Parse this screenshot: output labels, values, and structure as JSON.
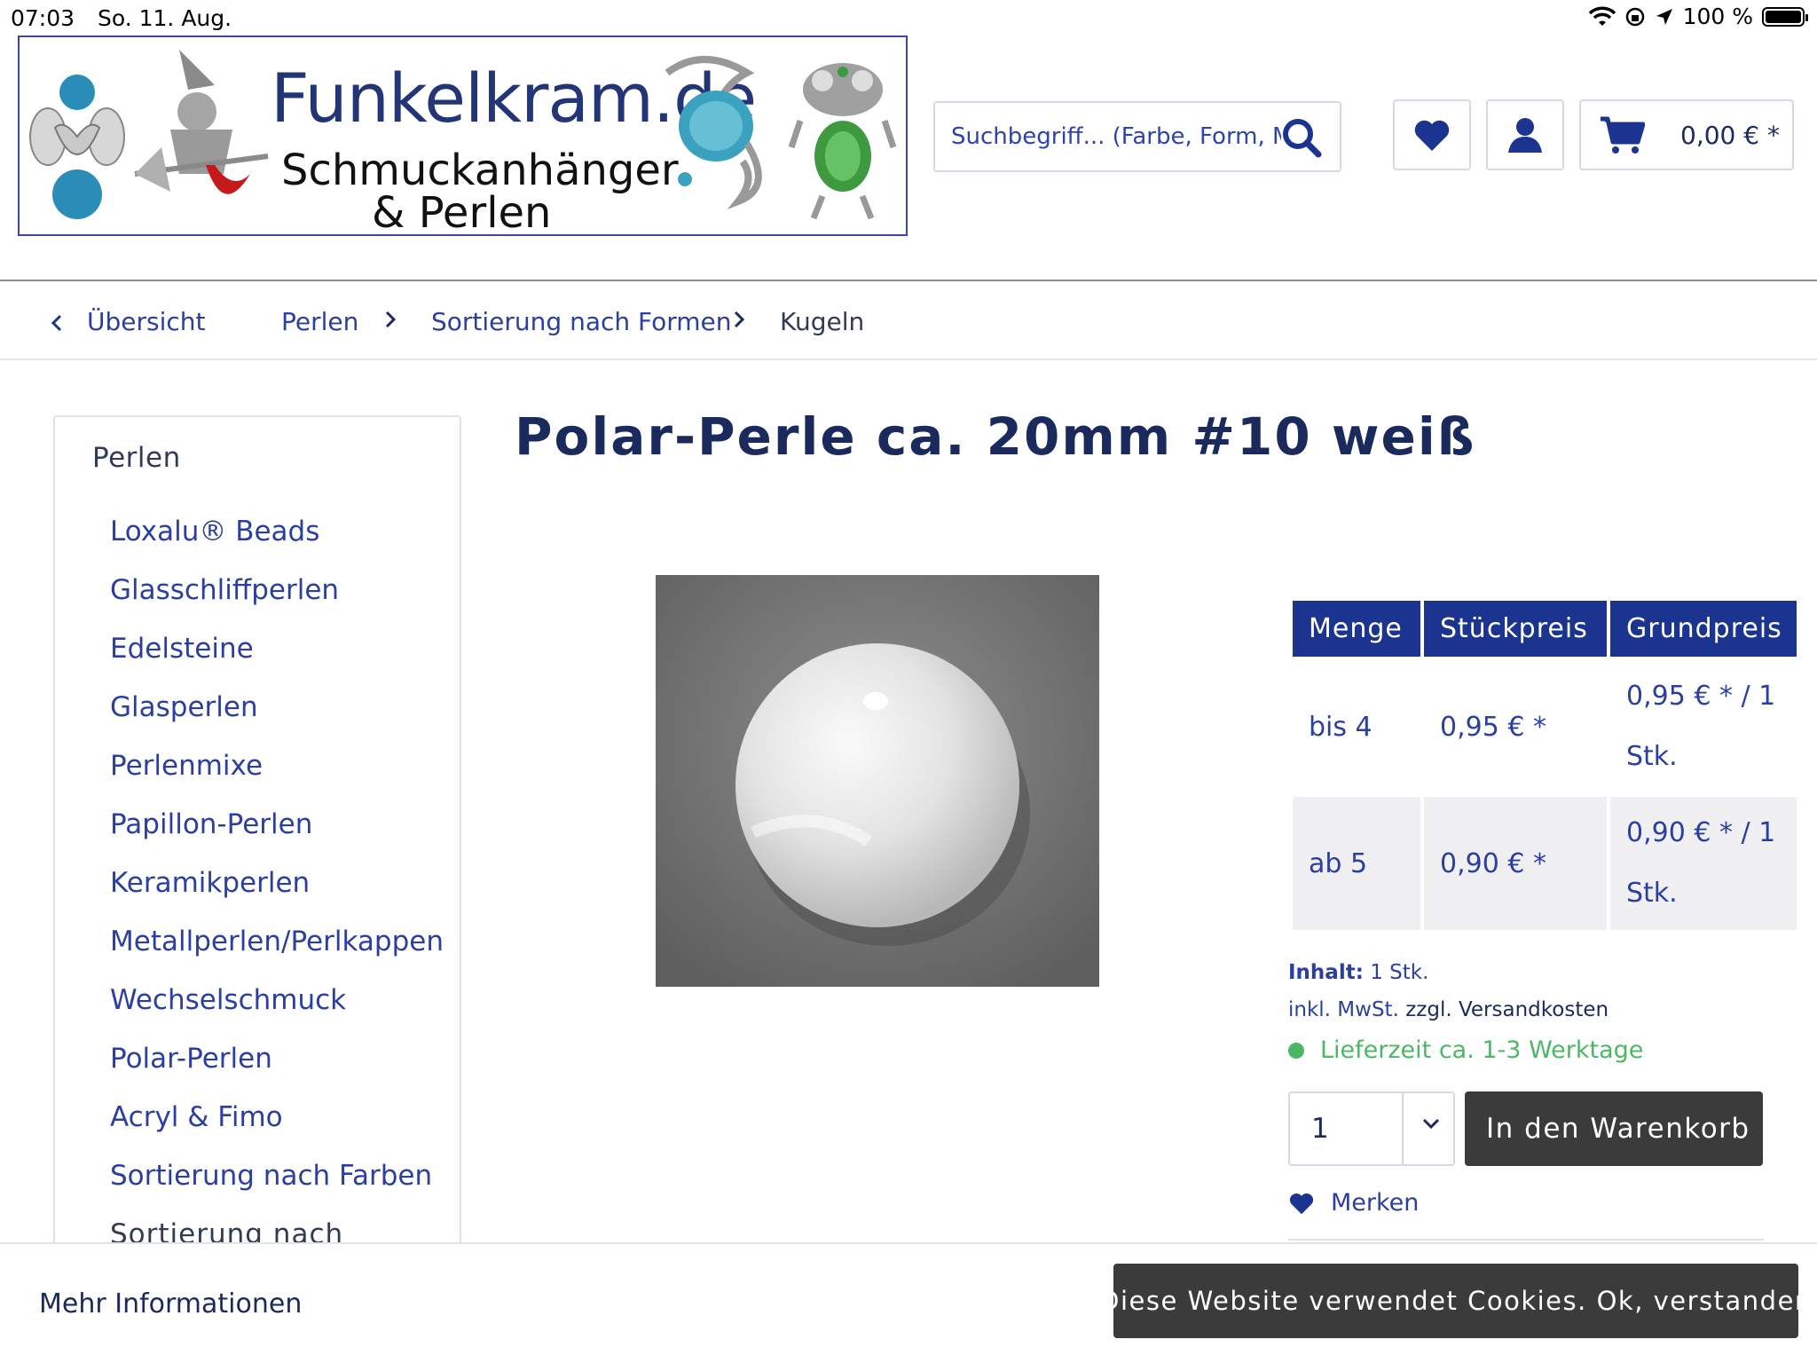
{
  "status_bar": {
    "time": "07:03",
    "date": "So. 11. Aug.",
    "battery": "100 %"
  },
  "header": {
    "logo_title": "Funkelkram.de",
    "logo_subtitle_1": "Schmuckanhänger",
    "logo_subtitle_2": "& Perlen",
    "search_placeholder": "Suchbegriff... (Farbe, Form, Material)",
    "cart_amount": "0,00 € *"
  },
  "breadcrumb": {
    "back": "Übersicht",
    "items": [
      "Perlen",
      "Sortierung nach Formen",
      "Kugeln"
    ]
  },
  "sidebar": {
    "heading": "Perlen",
    "items": [
      "Loxalu® Beads",
      "Glasschliffperlen",
      "Edelsteine",
      "Glasperlen",
      "Perlenmixe",
      "Papillon-Perlen",
      "Keramikperlen",
      "Metallperlen/Perlkappen",
      "Wechselschmuck",
      "Polar-Perlen",
      "Acryl & Fimo",
      "Sortierung nach Farben",
      "Sortierung nach"
    ]
  },
  "product": {
    "title": "Polar-Perle ca. 20mm #10 weiß",
    "price_table": {
      "headers": [
        "Menge",
        "Stückpreis",
        "Grundpreis"
      ],
      "rows": [
        {
          "menge": "bis 4",
          "stueckpreis": "0,95 € *",
          "grundpreis_1": "0,95 € * / 1",
          "grundpreis_2": "Stk."
        },
        {
          "menge": "ab 5",
          "stueckpreis": "0,90 € *",
          "grundpreis_1": "0,90 € * / 1",
          "grundpreis_2": "Stk."
        }
      ]
    },
    "content_label": "Inhalt:",
    "content_value": "1 Stk.",
    "tax_text": "inkl. MwSt.",
    "shipping_text": "zzgl. Versandkosten",
    "delivery": "Lieferzeit ca. 1-3 Werktage",
    "quantity": "1",
    "add_to_cart": "In den Warenkorb",
    "wishlist": "Merken"
  },
  "cookie_bar": {
    "more_info": "Mehr Informationen",
    "accept": "Diese Website verwendet Cookies. Ok, verstanden"
  },
  "colors": {
    "brand_blue": "#1b3490",
    "link_blue": "#2b3fa0",
    "dark_button": "#3b3b3b",
    "delivery_green": "#4cb865"
  }
}
